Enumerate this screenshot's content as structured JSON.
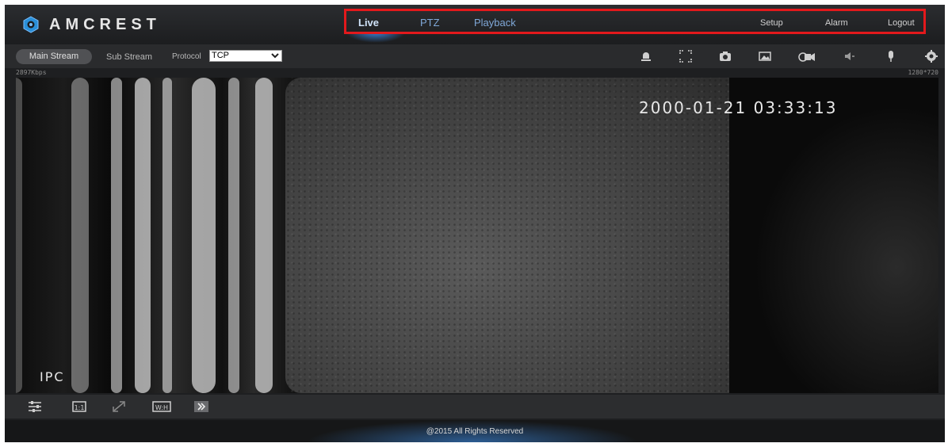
{
  "brand": {
    "name": "AMCREST",
    "logo_icon": "amcrest-logo-icon"
  },
  "nav": {
    "live": "Live",
    "ptz": "PTZ",
    "playback": "Playback",
    "setup": "Setup",
    "alarm": "Alarm",
    "logout": "Logout"
  },
  "toolbar": {
    "main_stream": "Main Stream",
    "sub_stream": "Sub Stream",
    "protocol_label": "Protocol",
    "protocol_value": "TCP",
    "icons": [
      "alarm-light-icon",
      "fullscreen-icon",
      "snapshot-icon",
      "image-icon",
      "record-icon",
      "speaker-icon",
      "microphone-icon",
      "settings-icon"
    ]
  },
  "stream": {
    "bitrate": "2897Kbps",
    "resolution": "1280*720",
    "timestamp": "2000-01-21 03:33:13",
    "osd_label": "IPC"
  },
  "bottom_toolbar": {
    "icons": [
      "image-adjust-icon",
      "original-size-icon",
      "zoom-icon",
      "wh-ratio-icon",
      "fluency-icon"
    ]
  },
  "footer": {
    "copyright": "@2015 All Rights Reserved"
  },
  "colors": {
    "highlight_border": "#e3191c",
    "nav_active": "#cfe2f8",
    "background": "#1e1f21"
  }
}
